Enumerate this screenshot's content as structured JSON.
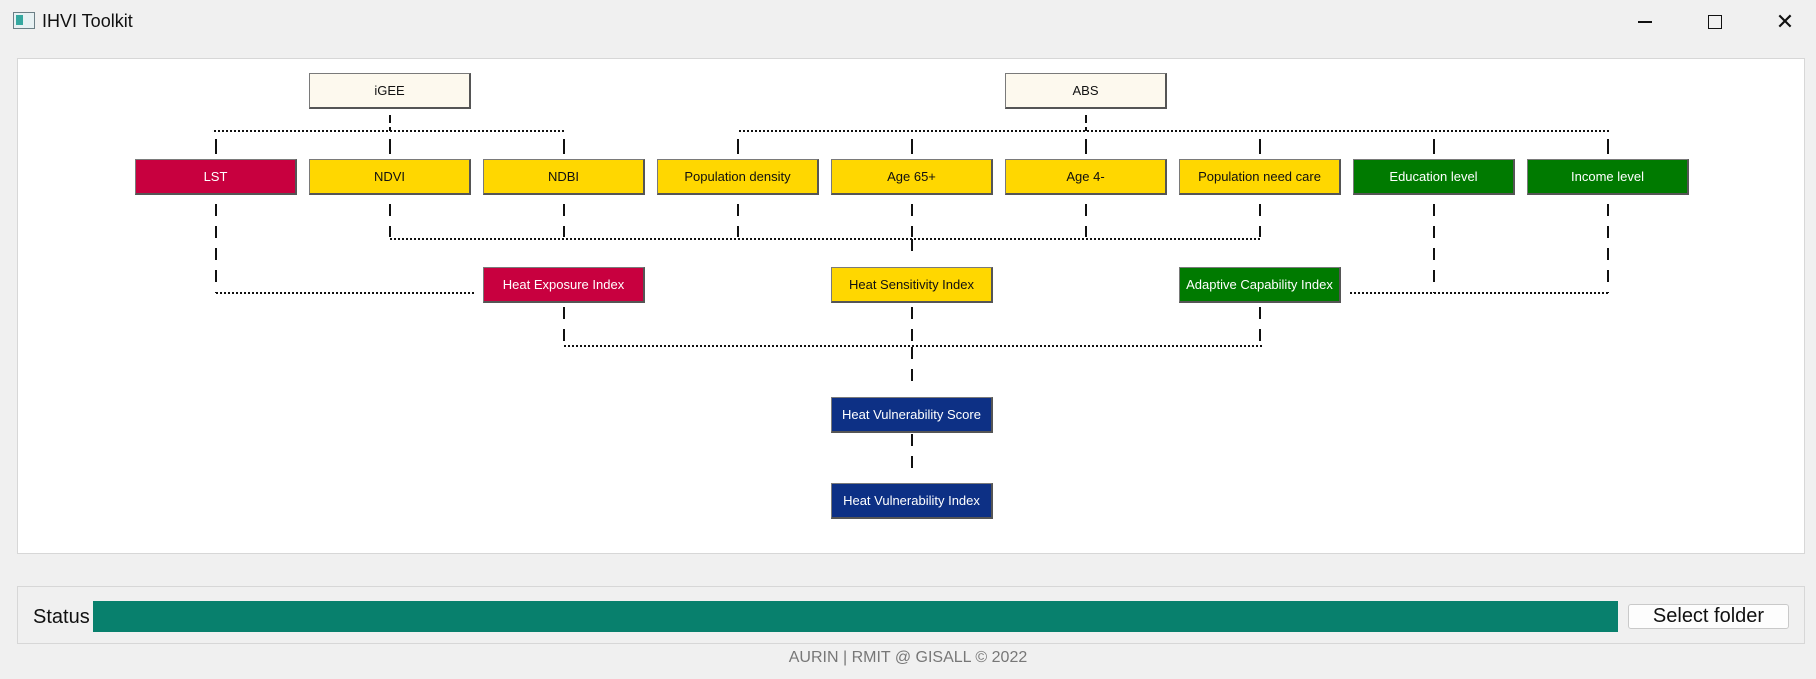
{
  "window": {
    "title": "IHVI Toolkit",
    "icons": {
      "app": "app-window-icon",
      "minimize": "minimize-icon",
      "maximize": "maximize-icon",
      "close": "close-icon"
    }
  },
  "diagram": {
    "sources": {
      "igee": "iGEE",
      "abs": "ABS"
    },
    "indicators": {
      "lst": "LST",
      "ndvi": "NDVI",
      "ndbi": "NDBI",
      "population_density": "Population density",
      "age_65_plus": "Age 65+",
      "age_4_minus": "Age 4-",
      "population_need_care": "Population need care",
      "education_level": "Education level",
      "income_level": "Income level"
    },
    "indices": {
      "heat_exposure": "Heat Exposure Index",
      "heat_sensitivity": "Heat Sensitivity Index",
      "adaptive_capability": "Adaptive Capability Index"
    },
    "score": "Heat Vulnerability Score",
    "final_index": "Heat Vulnerability Index",
    "colors": {
      "source": "#fdf9ee",
      "exposure": "#c8003f",
      "sensitivity": "#ffd700",
      "capability": "#007a00",
      "vulnerability": "#0d3085"
    }
  },
  "status": {
    "label": "Status",
    "progress": 1.0,
    "progress_color": "#08806d",
    "select_folder_label": "Select folder"
  },
  "footer": "AURIN | RMIT @ GISALL © 2022"
}
